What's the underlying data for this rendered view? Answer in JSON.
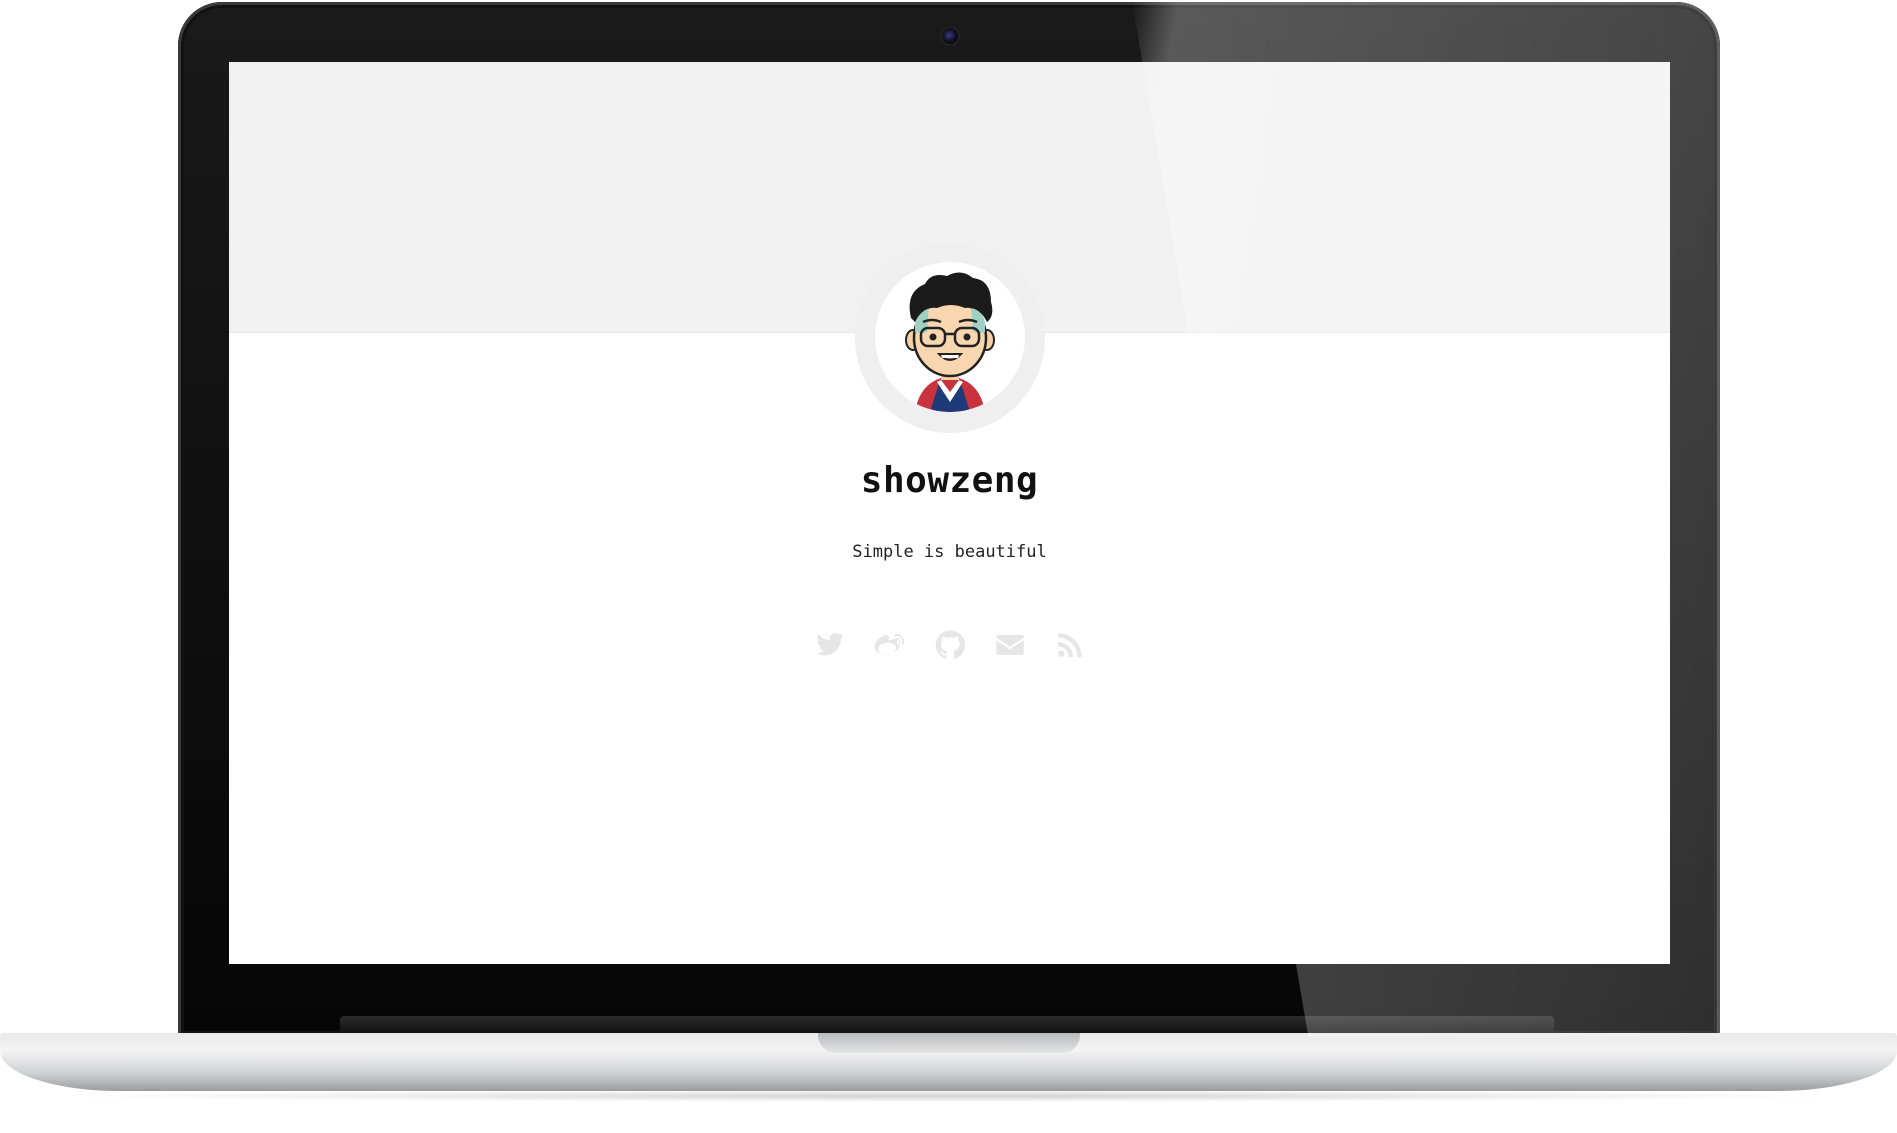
{
  "profile": {
    "name": "showzeng",
    "motto": "Simple is beautiful"
  },
  "social_links": [
    {
      "icon": "twitter-icon"
    },
    {
      "icon": "weibo-icon"
    },
    {
      "icon": "github-icon"
    },
    {
      "icon": "mail-icon"
    },
    {
      "icon": "rss-icon"
    }
  ],
  "colors": {
    "cover_background": "#f1f1f1",
    "avatar_ring": "#efefef",
    "social_icon": "#e6e6e6",
    "text": "#111111"
  }
}
